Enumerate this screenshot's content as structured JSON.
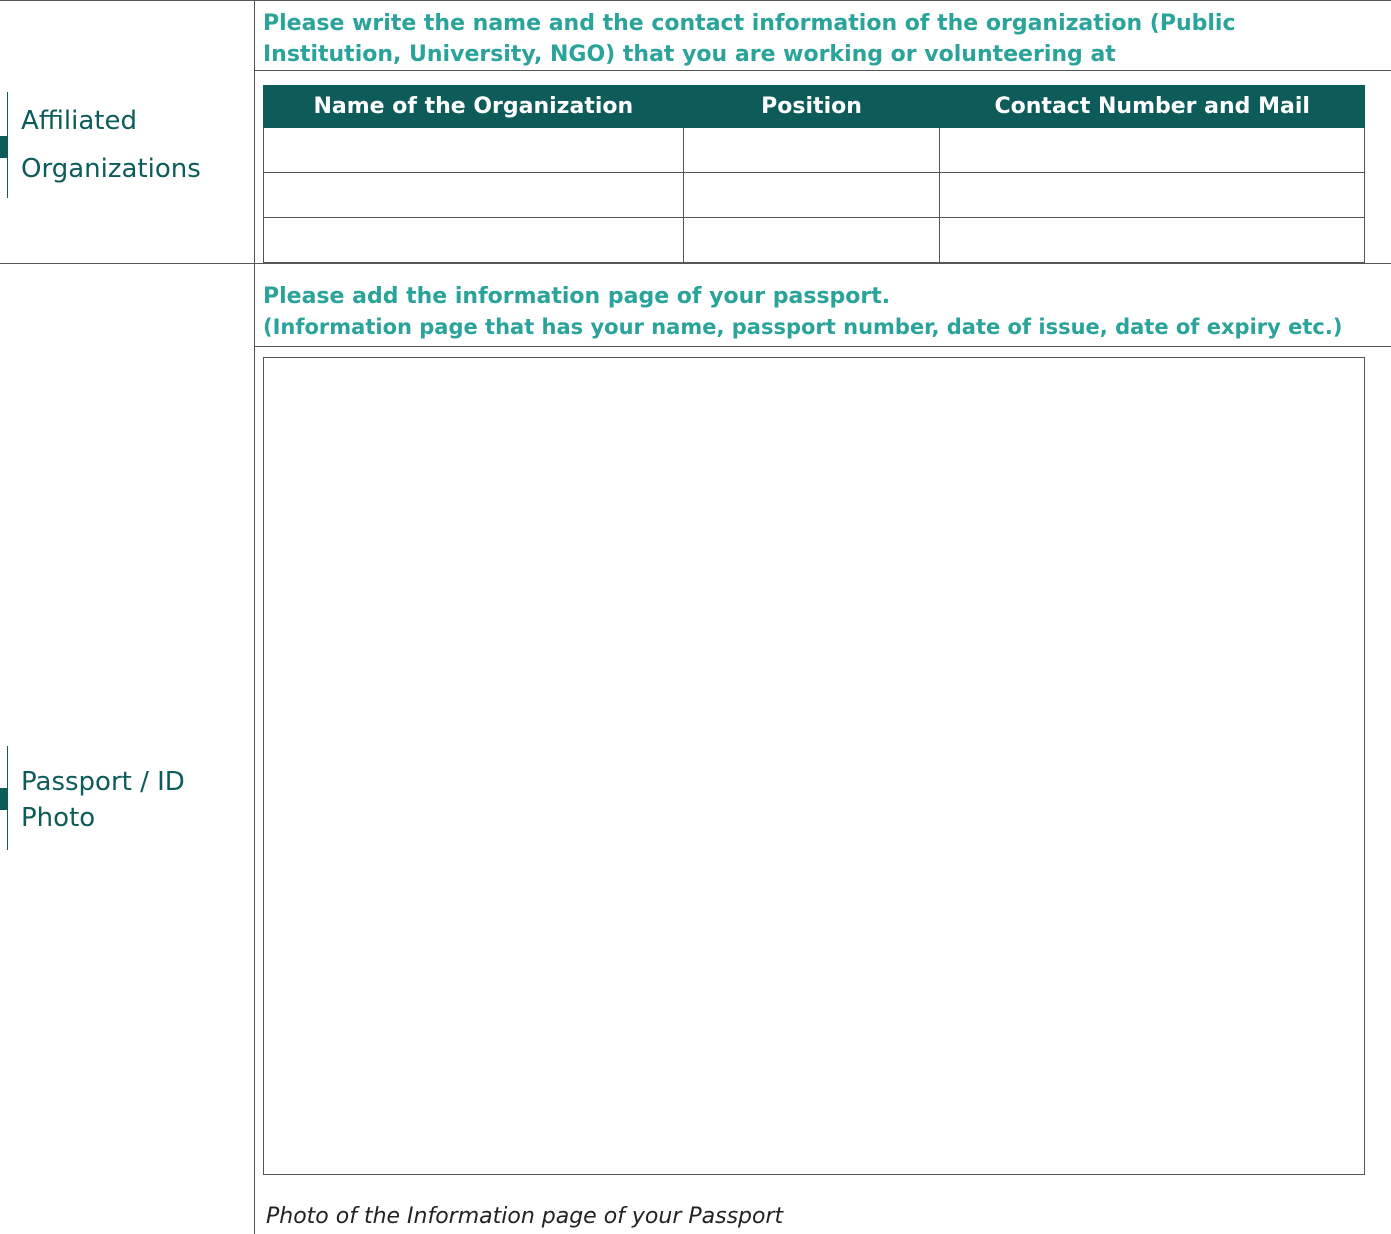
{
  "affiliated": {
    "label_line1": "Affiliated",
    "label_line2": "Organizations",
    "instruction": "Please write the name and the contact information of the organization (Public Institution, University, NGO) that you are working or volunteering at",
    "table": {
      "headers": [
        "Name of the Organization",
        "Position",
        "Contact Number and Mail"
      ],
      "rows": [
        [
          "",
          "",
          ""
        ],
        [
          "",
          "",
          ""
        ],
        [
          "",
          "",
          ""
        ]
      ]
    }
  },
  "passport": {
    "label_line1": "Passport / ID",
    "label_line2": "Photo",
    "instruction_line1": "Please add the information page of your passport.",
    "instruction_line2": "(Information page that has your name, passport number, date of issue, date of expiry etc.)",
    "caption": "Photo of the Information page of your Passport"
  },
  "colors": {
    "teal_dark": "#0d5c5a",
    "teal_light": "#2aa39b",
    "rule": "#555555"
  }
}
